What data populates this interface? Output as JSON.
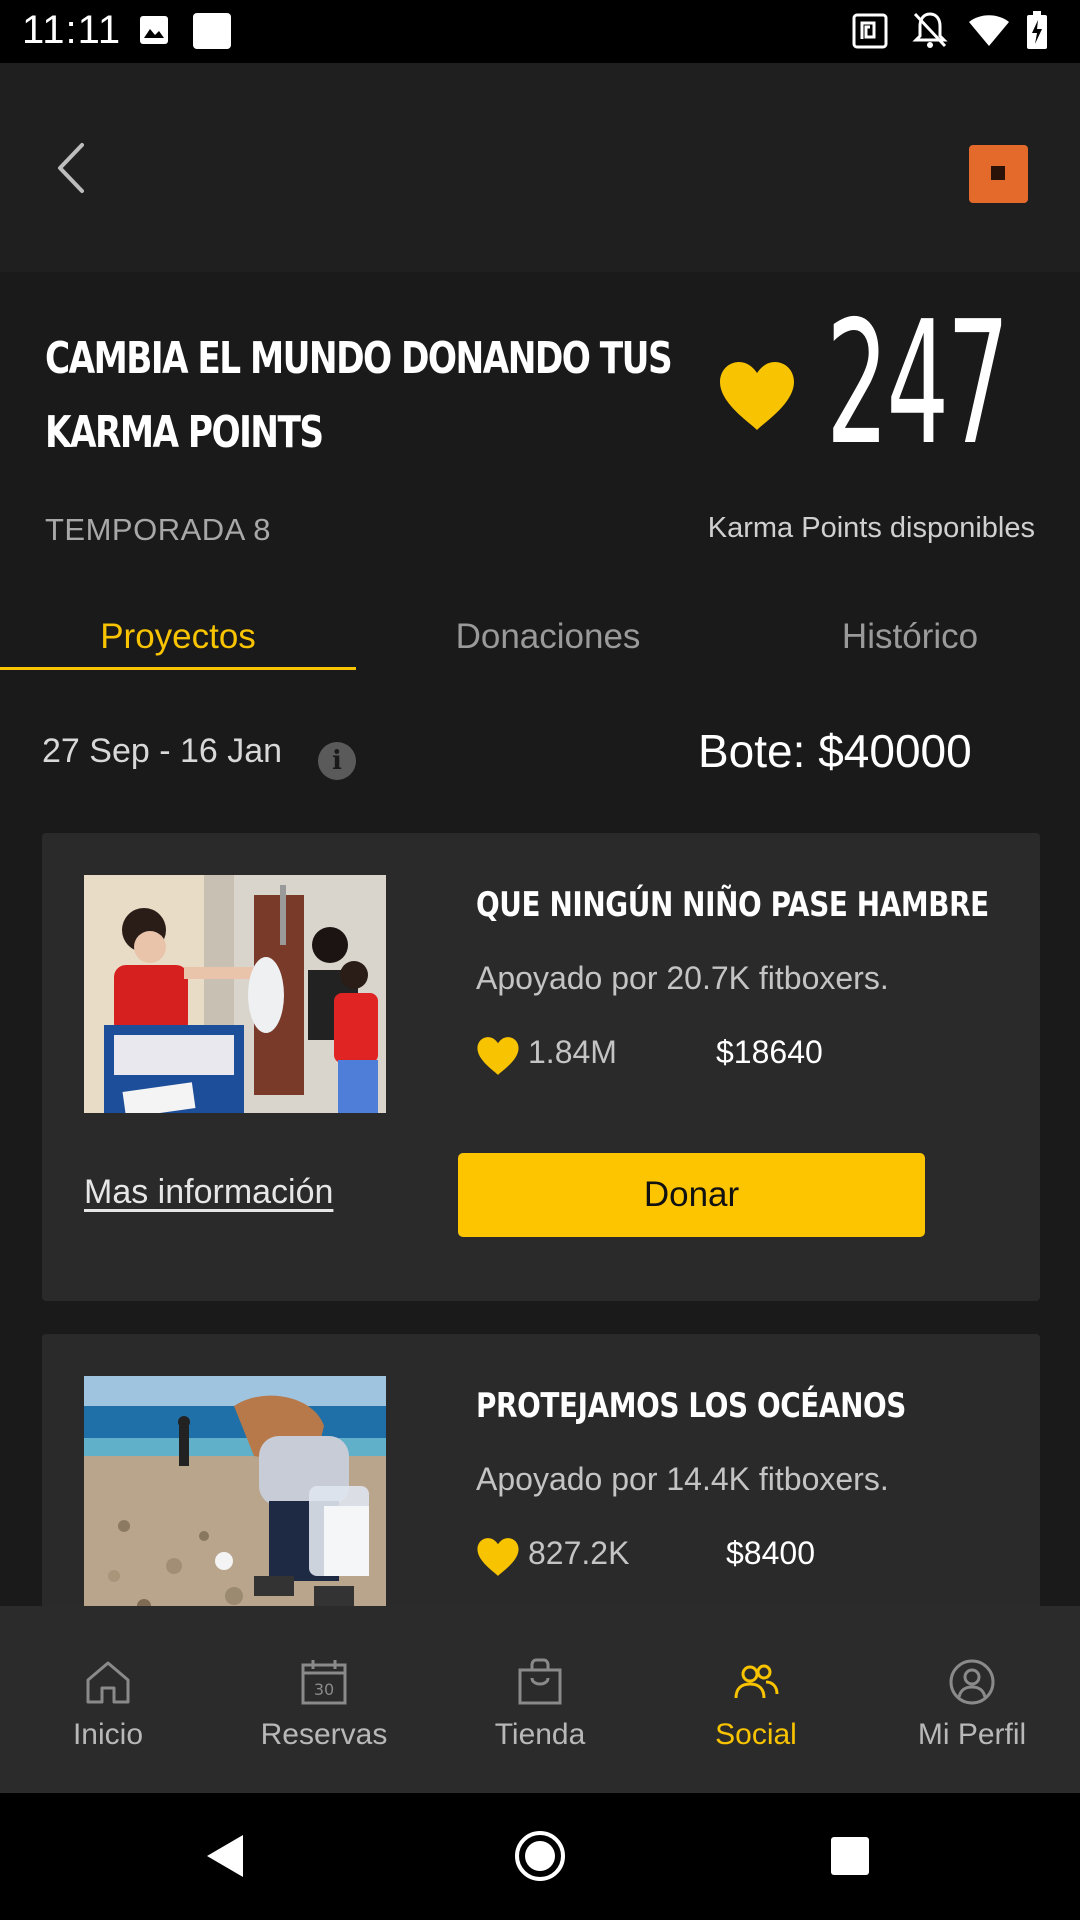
{
  "status_bar": {
    "time": "11:11",
    "icons": [
      "image-icon",
      "square-notification-icon",
      "nfc-icon",
      "bell-off-icon",
      "wifi-icon",
      "battery-charging-icon"
    ]
  },
  "app_bar": {
    "back_icon": "chevron-left-icon",
    "brand_icon": "brand-square-icon",
    "brand_color": "#e46a2c"
  },
  "header": {
    "title_line1": "CAMBIA EL MUNDO DONANDO TUS",
    "title_line2": "KARMA POINTS",
    "points": "247",
    "season": "TEMPORADA 8",
    "points_caption": "Karma Points disponibles"
  },
  "tabs": [
    {
      "label": "Proyectos",
      "active": true
    },
    {
      "label": "Donaciones",
      "active": false
    },
    {
      "label": "Histórico",
      "active": false
    }
  ],
  "period": {
    "date_range": "27 Sep - 16 Jan",
    "info_icon": "i",
    "pot": "Bote: $40000"
  },
  "projects": [
    {
      "title": "QUE NINGÚN NIÑO PASE HAMBRE",
      "support": "Apoyado por 20.7K fitboxers.",
      "karma": "1.84M",
      "money": "$18640",
      "more_info": "Mas información",
      "donate": "Donar"
    },
    {
      "title": "PROTEJAMOS LOS OCÉANOS",
      "support": "Apoyado por 14.4K fitboxers.",
      "karma": "827.2K",
      "money": "$8400"
    }
  ],
  "bottom_nav": [
    {
      "label": "Inicio",
      "icon": "home-icon",
      "active": false
    },
    {
      "label": "Reservas",
      "icon": "calendar-icon",
      "calendar_day": "30",
      "active": false
    },
    {
      "label": "Tienda",
      "icon": "shopping-bag-icon",
      "active": false
    },
    {
      "label": "Social",
      "icon": "people-icon",
      "active": true
    },
    {
      "label": "Mi Perfil",
      "icon": "profile-icon",
      "active": false
    }
  ],
  "colors": {
    "accent": "#f8c300",
    "button": "#fcc500",
    "background": "#1a1a1a",
    "card": "#2a2a2a",
    "nav": "#2b2b2b"
  },
  "system_nav": [
    "back-triangle-icon",
    "home-circle-icon",
    "recents-square-icon"
  ]
}
